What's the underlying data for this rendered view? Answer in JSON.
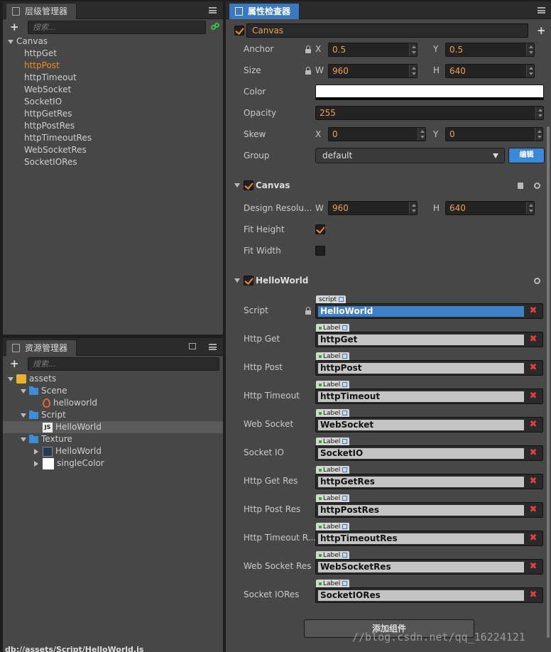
{
  "hierarchy": {
    "tab_title": "层级管理器",
    "search_placeholder": "搜索...",
    "root": "Canvas",
    "nodes": [
      "httpGet",
      "httpPost",
      "httpTimeout",
      "WebSocket",
      "SocketIO",
      "httpGetRes",
      "httpPostRes",
      "httpTimeoutRes",
      "WebSocketRes",
      "SocketIORes"
    ],
    "selected": "httpPost"
  },
  "assets": {
    "tab_title": "资源管理器",
    "search_placeholder": "搜索...",
    "root": "assets",
    "scene_folder": "Scene",
    "scene_file": "helloworld",
    "script_folder": "Script",
    "script_file": "HelloWorld",
    "script_file_icon": "JS",
    "texture_folder": "Texture",
    "texture_hello": "HelloWorld",
    "texture_single": "singleColor",
    "status_path": "db://assets/Script/HelloWorld.js"
  },
  "inspector": {
    "tab_title": "属性检查器",
    "node_name": "Canvas",
    "props": {
      "anchor_label": "Anchor",
      "anchor_x": "0.5",
      "anchor_y": "0.5",
      "size_label": "Size",
      "size_w": "960",
      "size_h": "640",
      "color_label": "Color",
      "color_value": "#ffffff",
      "opacity_label": "Opacity",
      "opacity_value": "255",
      "skew_label": "Skew",
      "skew_x": "0",
      "skew_y": "0",
      "group_label": "Group",
      "group_value": "default",
      "group_edit": "编辑",
      "axis_x": "X",
      "axis_y": "Y",
      "axis_w": "W",
      "axis_h": "H"
    },
    "canvas_component": {
      "title": "Canvas",
      "design_label": "Design Resolu...",
      "design_w": "960",
      "design_h": "640",
      "fit_height_label": "Fit Height",
      "fit_height": true,
      "fit_width_label": "Fit Width",
      "fit_width": false
    },
    "helloworld_component": {
      "title": "HelloWorld",
      "script_label": "Script",
      "script_tag": "script",
      "script_value": "HelloWorld",
      "label_tag": "Label",
      "fields": [
        {
          "label": "Http Get",
          "value": "httpGet"
        },
        {
          "label": "Http Post",
          "value": "httpPost"
        },
        {
          "label": "Http Timeout",
          "value": "httpTimeout"
        },
        {
          "label": "Web Socket",
          "value": "WebSocket"
        },
        {
          "label": "Socket IO",
          "value": "SocketIO"
        },
        {
          "label": "Http Get Res",
          "value": "httpGetRes"
        },
        {
          "label": "Http Post Res",
          "value": "httpPostRes"
        },
        {
          "label": "Http Timeout R...",
          "value": "httpTimeoutRes"
        },
        {
          "label": "Web Socket Res",
          "value": "WebSocketRes"
        },
        {
          "label": "Socket IORes",
          "value": "SocketIORes"
        }
      ],
      "clear_glyph": "✖"
    },
    "add_component": "添加组件"
  },
  "watermark": "//blog.csdn.net/qq_16224121",
  "colors": {
    "accent": "#3a79c0",
    "orange": "#f08a24",
    "remove": "#e24040"
  }
}
